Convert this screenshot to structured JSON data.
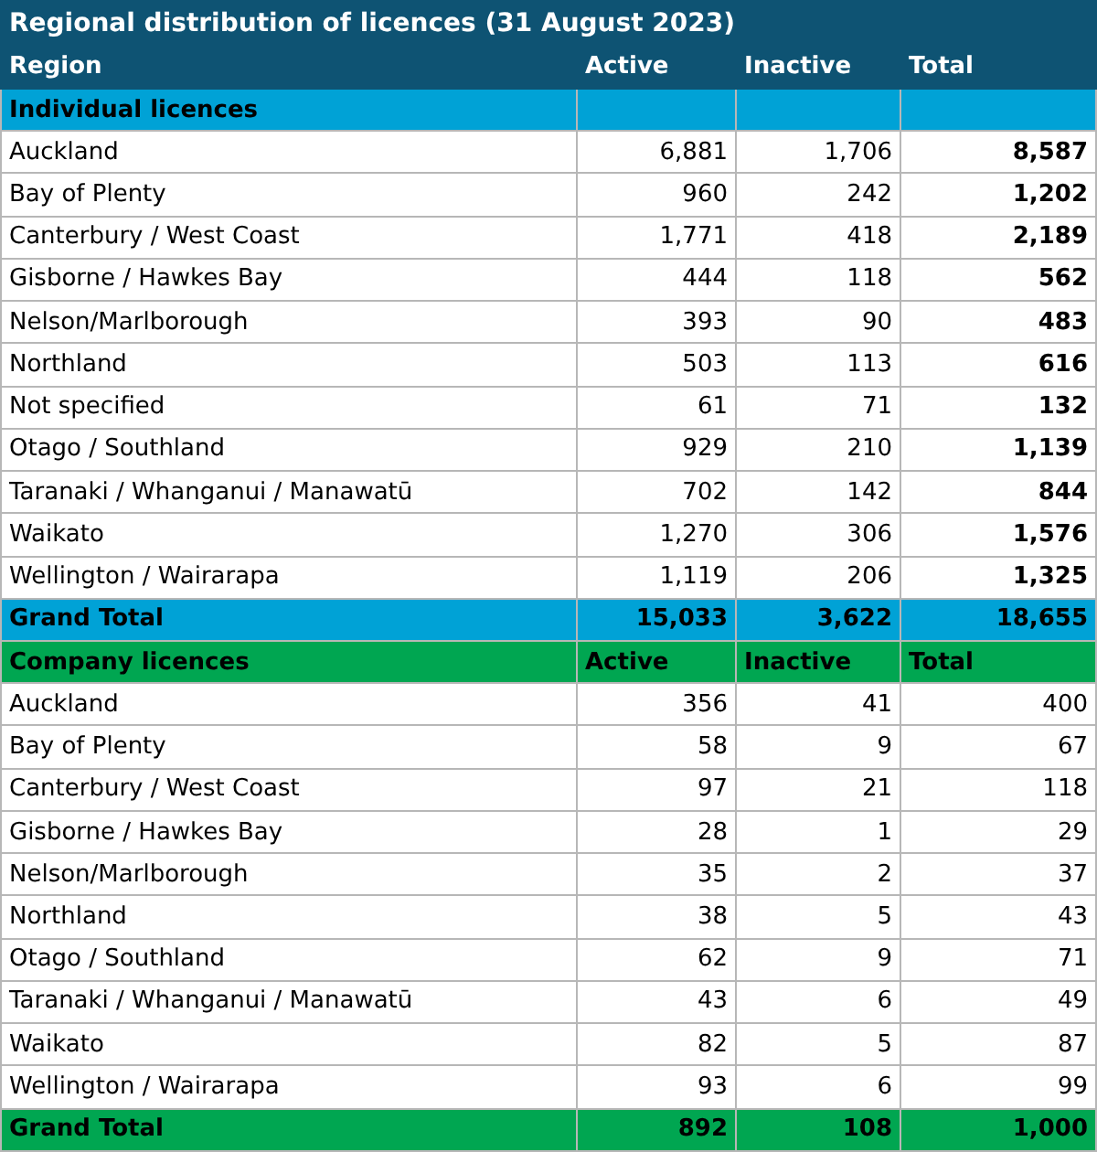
{
  "title": "Regional distribution of licences (31 August 2023)",
  "columns": [
    "Region",
    "Active",
    "Inactive",
    "Total"
  ],
  "sections": [
    {
      "label": "Individual licences",
      "color": "#00a2d6",
      "bold_totals": true,
      "rows": [
        {
          "region": "Auckland",
          "active": "6,881",
          "inactive": "1,706",
          "total": "8,587"
        },
        {
          "region": "Bay of Plenty",
          "active": "960",
          "inactive": "242",
          "total": "1,202"
        },
        {
          "region": "Canterbury / West Coast",
          "active": "1,771",
          "inactive": "418",
          "total": "2,189"
        },
        {
          "region": "Gisborne / Hawkes Bay",
          "active": "444",
          "inactive": "118",
          "total": "562"
        },
        {
          "region": "Nelson/Marlborough",
          "active": "393",
          "inactive": "90",
          "total": "483"
        },
        {
          "region": "Northland",
          "active": "503",
          "inactive": "113",
          "total": "616"
        },
        {
          "region": "Not specified",
          "active": "61",
          "inactive": "71",
          "total": "132"
        },
        {
          "region": "Otago / Southland",
          "active": "929",
          "inactive": "210",
          "total": "1,139"
        },
        {
          "region": "Taranaki / Whanganui / Manawatū",
          "active": "702",
          "inactive": "142",
          "total": "844"
        },
        {
          "region": "Waikato",
          "active": "1,270",
          "inactive": "306",
          "total": "1,576"
        },
        {
          "region": "Wellington / Wairarapa",
          "active": "1,119",
          "inactive": "206",
          "total": "1,325"
        }
      ],
      "grand_total": {
        "label": "Grand Total",
        "active": "15,033",
        "inactive": "3,622",
        "total": "18,655"
      }
    },
    {
      "label": "Company licences",
      "color": "#00a651",
      "headers": [
        "Active",
        "Inactive",
        "Total"
      ],
      "bold_totals": false,
      "rows": [
        {
          "region": "Auckland",
          "active": "356",
          "inactive": "41",
          "total": "400"
        },
        {
          "region": "Bay of Plenty",
          "active": "58",
          "inactive": "9",
          "total": "67"
        },
        {
          "region": "Canterbury / West Coast",
          "active": "97",
          "inactive": "21",
          "total": "118"
        },
        {
          "region": "Gisborne / Hawkes Bay",
          "active": "28",
          "inactive": "1",
          "total": "29"
        },
        {
          "region": "Nelson/Marlborough",
          "active": "35",
          "inactive": "2",
          "total": "37"
        },
        {
          "region": "Northland",
          "active": "38",
          "inactive": "5",
          "total": "43"
        },
        {
          "region": "Otago / Southland",
          "active": "62",
          "inactive": "9",
          "total": "71"
        },
        {
          "region": "Taranaki / Whanganui / Manawatū",
          "active": "43",
          "inactive": "6",
          "total": "49"
        },
        {
          "region": "Waikato",
          "active": "82",
          "inactive": "5",
          "total": "87"
        },
        {
          "region": "Wellington / Wairarapa",
          "active": "93",
          "inactive": "6",
          "total": "99"
        }
      ],
      "grand_total": {
        "label": "Grand Total",
        "active": "892",
        "inactive": "108",
        "total": "1,000"
      }
    }
  ]
}
